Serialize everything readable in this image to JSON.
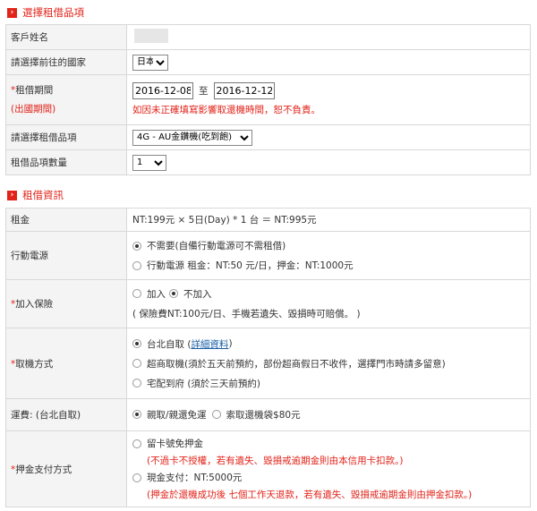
{
  "section1": {
    "title": "選擇租借品項",
    "customer_label": "客戶姓名",
    "country_label": "請選擇前往的國家",
    "country_value": "日本",
    "period_label": "租借期間",
    "period_note": "(出國期間)",
    "date_from": "2016-12-08",
    "date_sep": "至",
    "date_to": "2016-12-12",
    "period_warning": "如因未正確填寫影響取還機時間，恕不負責。",
    "item_label": "請選擇租借品項",
    "item_value": "4G - AU金鑽機(吃到飽)",
    "qty_label": "租借品項數量",
    "qty_value": "1"
  },
  "section2": {
    "title": "租借資訊",
    "rent_label": "租金",
    "rent_value": "NT:199元 × 5日(Day) * 1 台 ＝ NT:995元",
    "power_label": "行動電源",
    "power_opt1": "不需要(自備行動電源可不需租借)",
    "power_opt2": "行動電源 租金：NT:50 元/日，押金：NT:1000元",
    "ins_label": "加入保險",
    "ins_opt1": "加入",
    "ins_opt2": "不加入",
    "ins_note": "( 保險費NT:100元/日、手機若遺失、毀損時可賠償。 )",
    "pickup_label": "取機方式",
    "pickup_opt1_pre": "台北自取 ( ",
    "pickup_opt1_link": "詳細資料",
    "pickup_opt1_post": " )",
    "pickup_opt2": "超商取機(須於五天前預約，部份超商假日不收件，選擇門市時請多留意)",
    "pickup_opt3": "宅配到府 (須於三天前預約)",
    "ship_label": "運費: (台北自取)",
    "ship_opt1": "親取/親還免運",
    "ship_opt2": "索取還機袋$80元",
    "deposit_label": "押金支付方式",
    "deposit_opt1": "留卡號免押金",
    "deposit_note1": "(不過卡不授權，若有遺失、毀損戒逾期金則由本信用卡扣款。)",
    "deposit_opt2": "現金支付：NT:5000元",
    "deposit_note2": "(押金於還機成功後 七個工作天退款，若有遺失、毀損戒逾期金則由押金扣款。)"
  }
}
